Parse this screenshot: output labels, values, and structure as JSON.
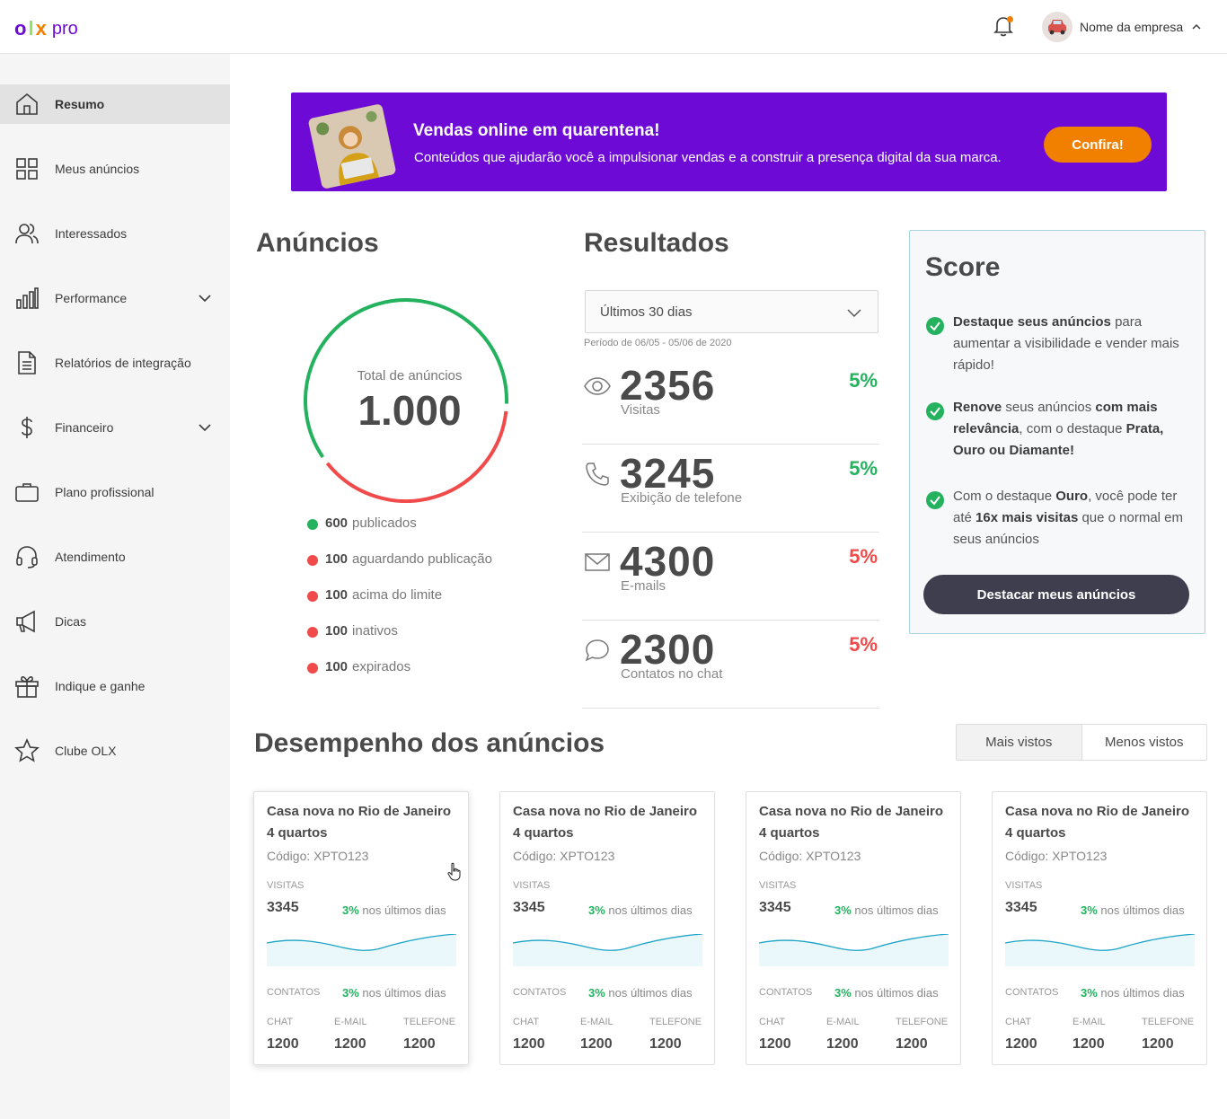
{
  "brand": {
    "o": "o",
    "l": "l",
    "x": "x",
    "pro": "pro"
  },
  "header": {
    "company_name": "Nome da empresa"
  },
  "sidebar": {
    "items": [
      {
        "label": "Resumo",
        "icon": "home-icon"
      },
      {
        "label": "Meus anúncios",
        "icon": "grid-icon"
      },
      {
        "label": "Interessados",
        "icon": "users-icon"
      },
      {
        "label": "Performance",
        "icon": "bar-chart-icon"
      },
      {
        "label": "Relatórios de integração",
        "icon": "document-icon"
      },
      {
        "label": "Financeiro",
        "icon": "dollar-icon"
      },
      {
        "label": "Plano profissional",
        "icon": "briefcase-icon"
      },
      {
        "label": "Atendimento",
        "icon": "headset-icon"
      },
      {
        "label": "Dicas",
        "icon": "megaphone-icon"
      },
      {
        "label": "Indique e ganhe",
        "icon": "gift-icon"
      },
      {
        "label": "Clube OLX",
        "icon": "star-icon"
      }
    ]
  },
  "banner": {
    "title": "Vendas online em quarentena!",
    "subtitle": "Conteúdos que ajudarão você a impulsionar vendas e a construir a presença digital da sua marca.",
    "button": "Confira!"
  },
  "anuncios": {
    "title": "Anúncios",
    "total_label": "Total de anúncios",
    "total_value": "1.000",
    "published_fraction": 0.6,
    "legend": [
      {
        "num": "600",
        "text": "publicados",
        "color": "#24b25f"
      },
      {
        "num": "100",
        "text": "aguardando publicação",
        "color": "#f04a4a"
      },
      {
        "num": "100",
        "text": "acima do limite",
        "color": "#f04a4a"
      },
      {
        "num": "100",
        "text": "inativos",
        "color": "#f04a4a"
      },
      {
        "num": "100",
        "text": "expirados",
        "color": "#f04a4a"
      }
    ]
  },
  "resultados": {
    "title": "Resultados",
    "period_select": "Últimos 30 dias",
    "period_note": "Período de 06/05 - 05/06 de 2020",
    "rows": [
      {
        "value": "2356",
        "caption": "Visitas",
        "pct": "5%",
        "color": "#24b25f",
        "icon": "eye-icon"
      },
      {
        "value": "3245",
        "caption": "Exibição de telefone",
        "pct": "5%",
        "color": "#24b25f",
        "icon": "phone-icon"
      },
      {
        "value": "4300",
        "caption": "E-mails",
        "pct": "5%",
        "color": "#f04a4a",
        "icon": "mail-icon"
      },
      {
        "value": "2300",
        "caption": "Contatos no chat",
        "pct": "5%",
        "color": "#f04a4a",
        "icon": "chat-icon"
      }
    ]
  },
  "score": {
    "title": "Score",
    "items": [
      {
        "b1": "Destaque seus anúncios",
        "t1": " para aumentar a visibilidade e vender mais rápido!"
      },
      {
        "t0": "Renove",
        "b1": " seus anúncios ",
        "b2": "com mais relevância",
        "t2": ", com o destaque ",
        "b3": "Prata, Ouro ou Diamante!"
      },
      {
        "t0": "Com o destaque ",
        "b1": "Ouro",
        "t1": ", você pode ter até ",
        "b2": "16x mais visitas",
        "t2": " que o normal em seus anúncios"
      }
    ],
    "button": "Destacar meus anúncios"
  },
  "desempenho": {
    "title": "Desempenho dos anúncios",
    "tabs": [
      "Mais vistos",
      "Menos vistos"
    ],
    "cards": [
      {
        "title": "Casa nova no Rio de Janeiro 4 quartos",
        "code": "Código: XPTO123",
        "visits_label": "VISITAS",
        "visits": "3345",
        "trend_pct": "3%",
        "trend_text": " nos últimos dias",
        "contacts_label": "CONTATOS",
        "chat_label": "CHAT",
        "email_label": "E-MAIL",
        "phone_label": "TELEFONE",
        "chat": "1200",
        "email": "1200",
        "phone": "1200"
      },
      {
        "title": "Casa nova no Rio de Janeiro 4 quartos",
        "code": "Código: XPTO123",
        "visits_label": "VISITAS",
        "visits": "3345",
        "trend_pct": "3%",
        "trend_text": " nos últimos dias",
        "contacts_label": "CONTATOS",
        "chat_label": "CHAT",
        "email_label": "E-MAIL",
        "phone_label": "TELEFONE",
        "chat": "1200",
        "email": "1200",
        "phone": "1200"
      },
      {
        "title": "Casa nova no Rio de Janeiro 4 quartos",
        "code": "Código: XPTO123",
        "visits_label": "VISITAS",
        "visits": "3345",
        "trend_pct": "3%",
        "trend_text": " nos últimos dias",
        "contacts_label": "CONTATOS",
        "chat_label": "CHAT",
        "email_label": "E-MAIL",
        "phone_label": "TELEFONE",
        "chat": "1200",
        "email": "1200",
        "phone": "1200"
      },
      {
        "title": "Casa nova no Rio de Janeiro 4 quartos",
        "code": "Código: XPTO123",
        "visits_label": "VISITAS",
        "visits": "3345",
        "trend_pct": "3%",
        "trend_text": " nos últimos dias",
        "contacts_label": "CONTATOS",
        "chat_label": "CHAT",
        "email_label": "E-MAIL",
        "phone_label": "TELEFONE",
        "chat": "1200",
        "email": "1200",
        "phone": "1200"
      }
    ]
  },
  "colors": {
    "purple": "#6e0ad6",
    "orange": "#f28000",
    "green": "#24b25f",
    "red": "#f04a4a",
    "dark_button": "#3e3e4f"
  }
}
